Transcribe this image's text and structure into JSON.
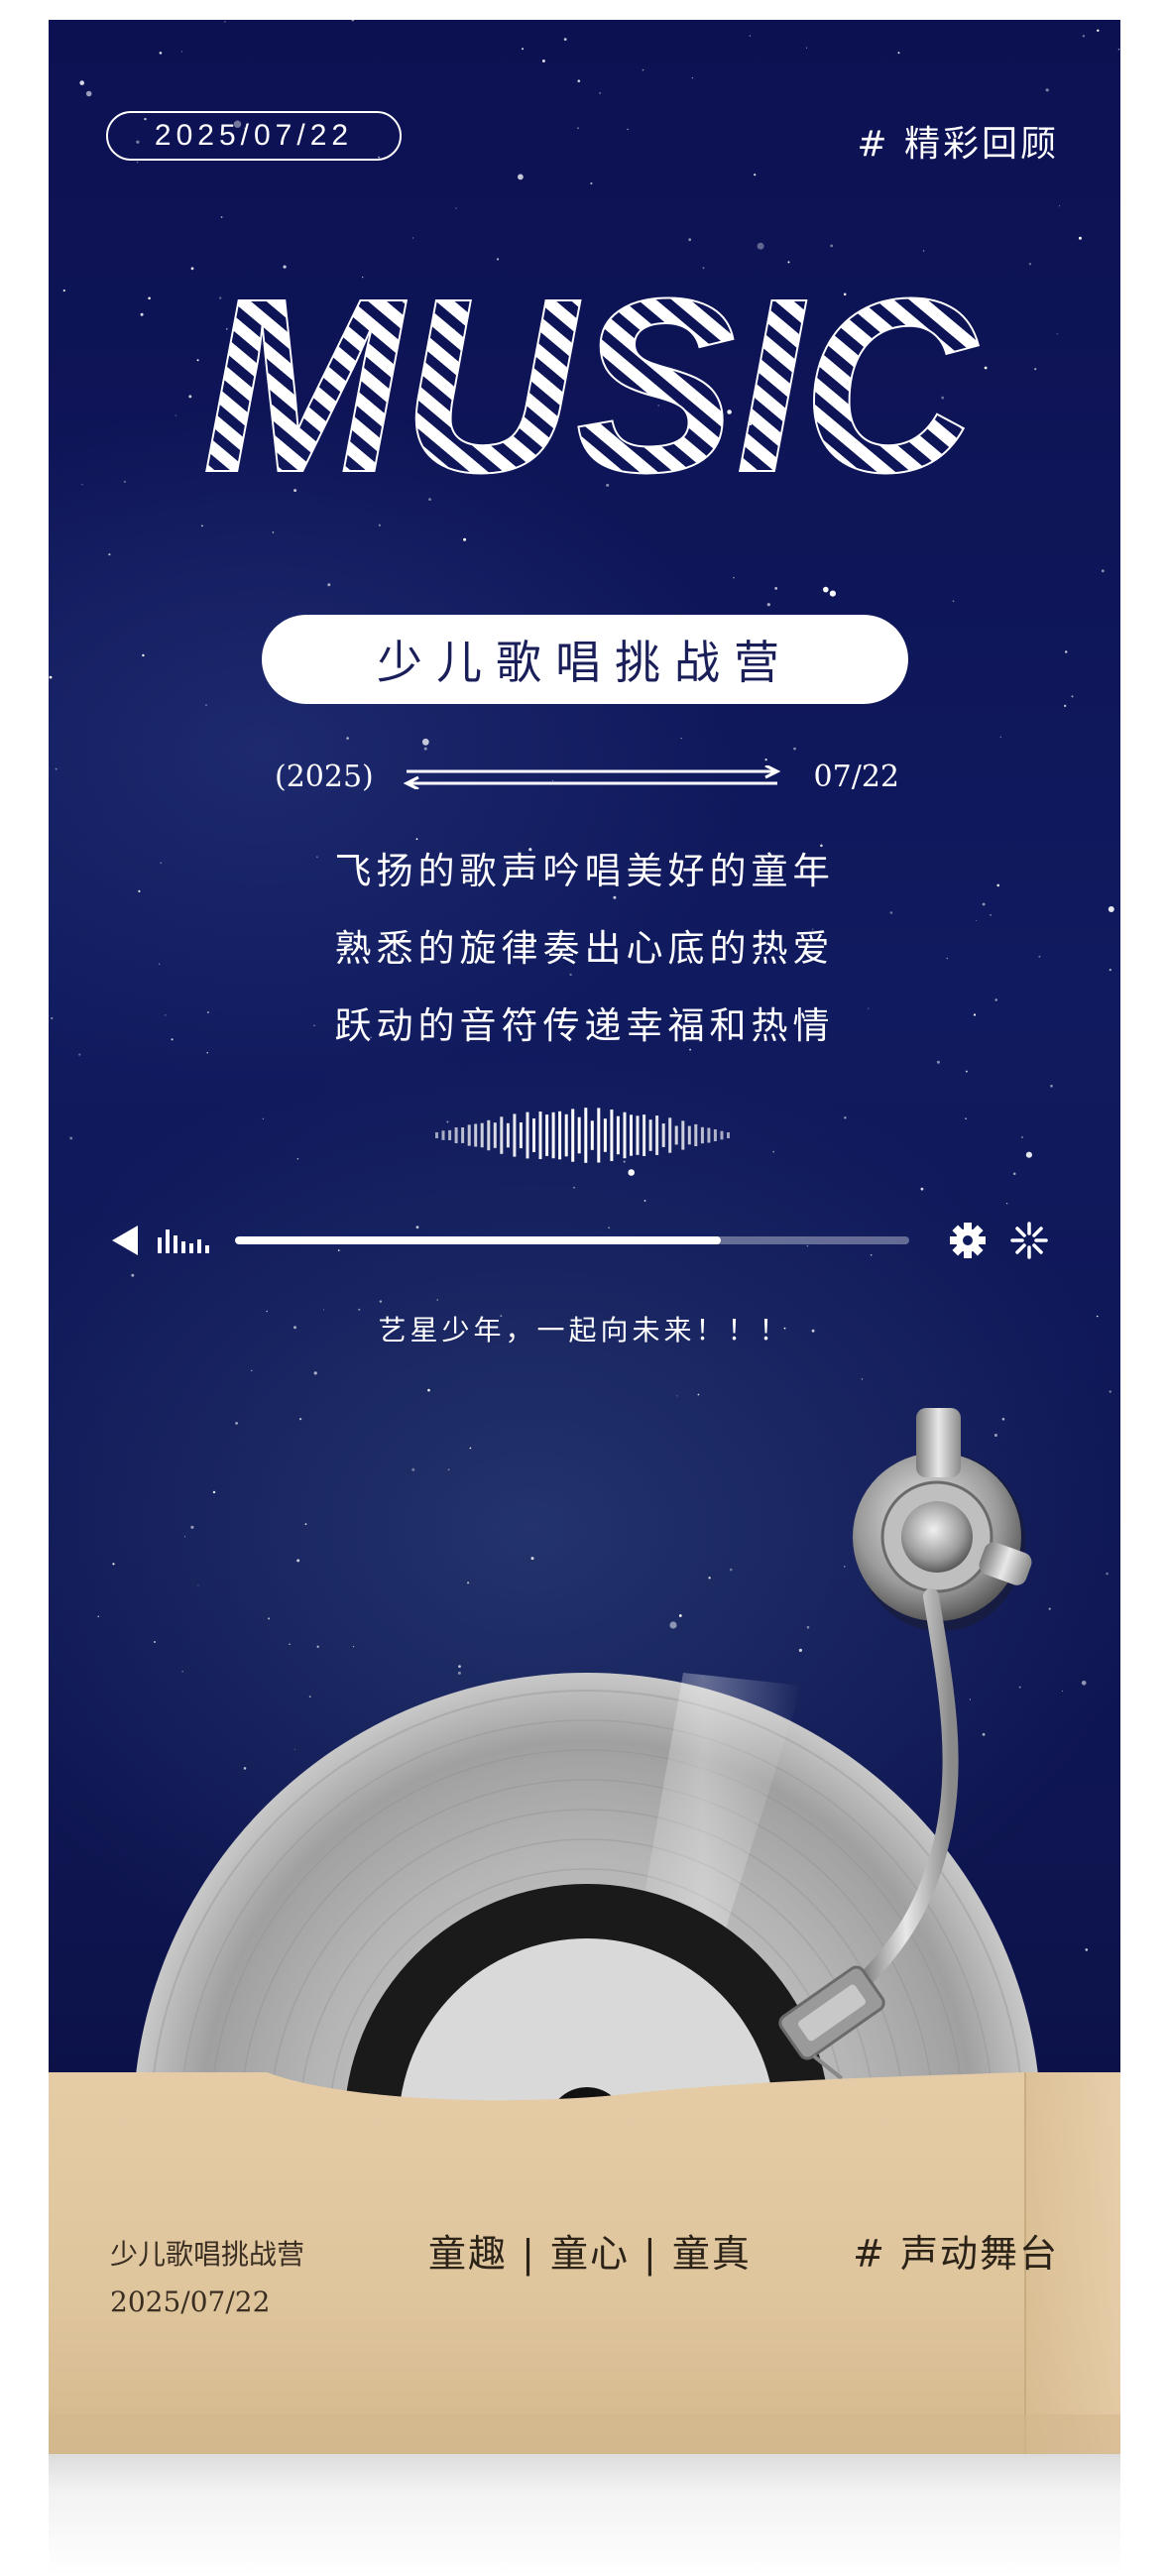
{
  "header": {
    "date_badge": "2025/07/22",
    "tag": "# 精彩回顾"
  },
  "title": {
    "main": "MUSIC",
    "subtitle": "少儿歌唱挑战营"
  },
  "timeline": {
    "left": "(2025)",
    "right": "07/22"
  },
  "poem": {
    "lines": [
      "飞扬的歌声吟唱美好的童年",
      "熟悉的旋律奏出心底的热爱",
      "跃动的音符传递幸福和热情"
    ]
  },
  "player": {
    "progress": 0.72,
    "icons": [
      "play-back-icon",
      "equalizer-icon",
      "gear-icon",
      "loading-icon"
    ]
  },
  "slogan": "艺星少年，一起向未来！！！",
  "footer": {
    "name": "少儿歌唱挑战营",
    "date": "2025/07/22",
    "keywords": "童趣 | 童心 | 童真",
    "tag": "# 声动舞台"
  },
  "colors": {
    "background": "#0c1152",
    "sleeve": "#e2c8a0",
    "accent_text": "#1a1f5a"
  }
}
